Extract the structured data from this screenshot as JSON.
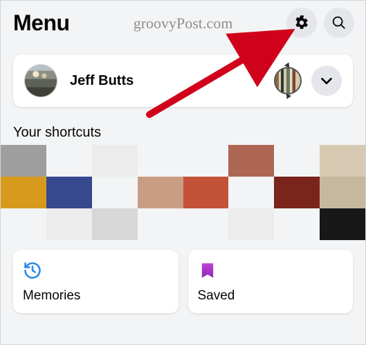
{
  "header": {
    "title": "Menu",
    "watermark": "groovyPost.com"
  },
  "profile": {
    "name": "Jeff Butts"
  },
  "shortcuts": {
    "label": "Your shortcuts",
    "rows": [
      [
        "#9e9e9e",
        "#f3f4f5",
        "#ececec",
        "#f3f4f5",
        "#f3f4f5",
        "#ad6651",
        "#f3f4f5",
        "#d7c9b2"
      ],
      [
        "#d79a1d",
        "#36498f",
        "#f3f4f5",
        "#c99d84",
        "#c35238",
        "#f3f4f5",
        "#7a241c",
        "#c6b79e"
      ],
      [
        "#f3f4f5",
        "#ececec",
        "#d7d7d7",
        "#f3f4f5",
        "#f3f4f5",
        "#ececec",
        "#f3f4f5",
        "#181818"
      ]
    ]
  },
  "tiles": {
    "memories": "Memories",
    "saved": "Saved"
  }
}
